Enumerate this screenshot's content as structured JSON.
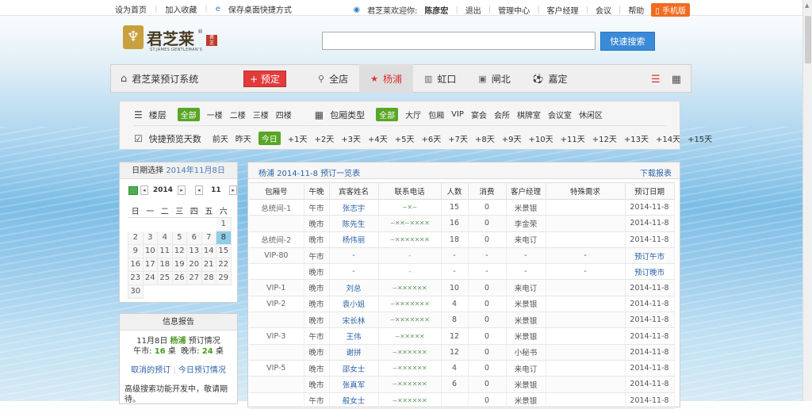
{
  "topbar": {
    "left": [
      "设为首页",
      "加入收藏",
      "保存桌面快捷方式"
    ],
    "welcome": "君芝莱欢迎你:",
    "user": "陈彦宏",
    "links": [
      "退出",
      "管理中心",
      "客户经理",
      "会议",
      "帮助"
    ],
    "phone": "手机版"
  },
  "logo": {
    "name": "君芝莱",
    "sub": "ST.JAMES GENTLEMAN'S",
    "reg": "®"
  },
  "search": {
    "placeholder": "",
    "button": "快速搜索"
  },
  "nav": {
    "system": "君芝莱预订系统",
    "book": "+ 预定",
    "tabs": [
      {
        "label": "全店",
        "icon": "location-icon"
      },
      {
        "label": "杨浦",
        "icon": "star-icon"
      },
      {
        "label": "虹口",
        "icon": "building-icon"
      },
      {
        "label": "闸北",
        "icon": "picture-icon"
      },
      {
        "label": "嘉定",
        "icon": "football-icon"
      }
    ],
    "active_tab": "杨浦"
  },
  "filter": {
    "floor_label": "楼层",
    "floors": [
      "全部",
      "一楼",
      "二楼",
      "三楼",
      "四楼"
    ],
    "room_type_label": "包厢类型",
    "room_types": [
      "全部",
      "大厅",
      "包厢",
      "VIP",
      "宴会",
      "会所",
      "棋牌室",
      "会议室",
      "休闲区"
    ],
    "days_label": "快捷预览天数",
    "days": [
      "前天",
      "昨天",
      "今日",
      "+1天",
      "+2天",
      "+3天",
      "+4天",
      "+5天",
      "+6天",
      "+7天",
      "+8天",
      "+9天",
      "+10天",
      "+11天",
      "+12天",
      "+13天",
      "+14天",
      "+15天"
    ]
  },
  "calendar": {
    "title": "日期选择",
    "date": "2014年11月8日",
    "year": "2014",
    "month": "11",
    "weekdays": [
      "日",
      "一",
      "二",
      "三",
      "四",
      "五",
      "六"
    ],
    "rows": [
      [
        "",
        "",
        "",
        "",
        "",
        "",
        "1"
      ],
      [
        "2",
        "3",
        "4",
        "5",
        "6",
        "7",
        "8"
      ],
      [
        "9",
        "10",
        "11",
        "12",
        "13",
        "14",
        "15"
      ],
      [
        "16",
        "17",
        "18",
        "19",
        "20",
        "21",
        "22"
      ],
      [
        "23",
        "24",
        "25",
        "26",
        "27",
        "28",
        "29"
      ],
      [
        "30",
        "",
        "",
        "",
        "",
        "",
        ""
      ]
    ],
    "selected": "8"
  },
  "info": {
    "title": "信息报告",
    "line1_a": "11月8日",
    "line1_b": "杨浦",
    "line1_c": "预订情况",
    "noon_label": "午市:",
    "noon_count": "16",
    "evening_label": "晚市:",
    "evening_count": "24",
    "unit": "桌",
    "link1": "取消的预订",
    "link2": "今日预订情况",
    "note": "高级搜索功能开发中，敬请期待。"
  },
  "main": {
    "title": "杨浦 2014-11-8 预订一览表",
    "download": "下载报表",
    "columns": [
      "包厢号",
      "午晚",
      "宾客姓名",
      "联系电话",
      "人数",
      "消费",
      "客户经理",
      "特殊需求",
      "预订日期"
    ],
    "rows": [
      {
        "room": "总统间-1",
        "meal": "午市",
        "name": "张志宇",
        "phone": "~✕~",
        "people": "15",
        "spend": "0",
        "manager": "米景银",
        "special": "",
        "date": "2014-11-8"
      },
      {
        "room": "",
        "meal": "晚市",
        "name": "陈先生",
        "phone": "~✕✕~✕✕✕✕",
        "people": "16",
        "spend": "0",
        "manager": "李金荣",
        "special": "",
        "date": "2014-11-8"
      },
      {
        "room": "总统间-2",
        "meal": "晚市",
        "name": "杨伟丽",
        "phone": "~✕✕✕✕✕✕✕",
        "people": "18",
        "spend": "0",
        "manager": "来电订",
        "special": "",
        "date": "2014-11-8"
      },
      {
        "room": "VIP-80",
        "meal": "午市",
        "name": "-",
        "phone": "-",
        "people": "-",
        "spend": "-",
        "manager": "-",
        "special": "-",
        "date": "预订午市"
      },
      {
        "room": "",
        "meal": "晚市",
        "name": "-",
        "phone": "-",
        "people": "-",
        "spend": "-",
        "manager": "-",
        "special": "-",
        "date": "预订晚市"
      },
      {
        "room": "VIP-1",
        "meal": "晚市",
        "name": "刘总",
        "phone": "~✕✕✕✕✕✕",
        "people": "10",
        "spend": "0",
        "manager": "来电订",
        "special": "",
        "date": "2014-11-8"
      },
      {
        "room": "VIP-2",
        "meal": "晚市",
        "name": "袁小姐",
        "phone": "~✕✕✕✕✕✕✕",
        "people": "4",
        "spend": "0",
        "manager": "米景银",
        "special": "",
        "date": "2014-11-8"
      },
      {
        "room": "",
        "meal": "晚市",
        "name": "宋长林",
        "phone": "~✕✕✕✕✕✕✕",
        "people": "8",
        "spend": "0",
        "manager": "米景银",
        "special": "",
        "date": "2014-11-8"
      },
      {
        "room": "VIP-3",
        "meal": "午市",
        "name": "王伟",
        "phone": "~✕✕✕✕✕",
        "people": "12",
        "spend": "0",
        "manager": "米景银",
        "special": "",
        "date": "2014-11-8"
      },
      {
        "room": "",
        "meal": "晚市",
        "name": "谢拼",
        "phone": "~✕✕✕✕✕✕",
        "people": "12",
        "spend": "0",
        "manager": "小秘书",
        "special": "",
        "date": "2014-11-8"
      },
      {
        "room": "VIP-5",
        "meal": "晚市",
        "name": "邵女士",
        "phone": "~✕✕✕✕✕✕",
        "people": "4",
        "spend": "0",
        "manager": "来电订",
        "special": "",
        "date": "2014-11-8"
      },
      {
        "room": "",
        "meal": "晚市",
        "name": "张真军",
        "phone": "~✕✕✕✕✕✕",
        "people": "6",
        "spend": "0",
        "manager": "米景银",
        "special": "",
        "date": "2014-11-8"
      },
      {
        "room": "",
        "meal": "午市",
        "name": "般女士",
        "phone": "~✕✕✕✕✕✕",
        "people": "",
        "spend": "0",
        "manager": "米景银",
        "special": "",
        "date": "2014-11-8"
      }
    ]
  },
  "colors": {
    "accent_green": "#58a626",
    "accent_red": "#e23b3b",
    "link_blue": "#2c62a8",
    "phone_orange": "#f36b1f"
  }
}
